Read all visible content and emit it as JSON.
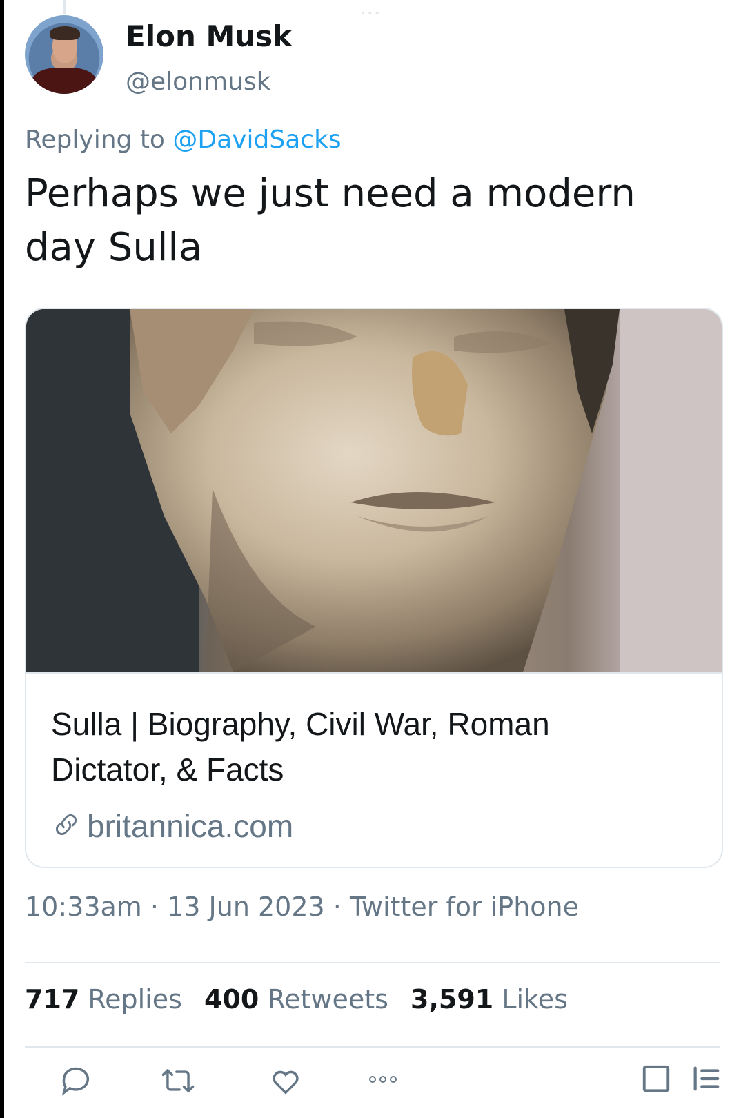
{
  "tweet": {
    "author_name": "Elon Musk",
    "author_handle": "@elonmusk",
    "replying_prefix": "Replying to",
    "replying_handle": "@DavidSacks",
    "text": "Perhaps we just need a modern day Sulla",
    "link_card": {
      "title": "Sulla | Biography, Civil War, Roman Dictator, & Facts",
      "domain": "britannica.com",
      "image_icon": "marble-bust-image"
    },
    "time": "10:33am",
    "date": "13 Jun 2023",
    "source": "Twitter for iPhone",
    "separator": "·",
    "stats": {
      "replies_count": "717",
      "replies_label": "Replies",
      "retweets_count": "400",
      "retweets_label": "Retweets",
      "likes_count": "3,591",
      "likes_label": "Likes"
    }
  },
  "actions": [
    "reply-icon",
    "retweet-icon",
    "like-icon",
    "more-icon",
    "share-icon",
    "menu-icon"
  ],
  "colors": {
    "accent": "#1da1f2",
    "secondary_text": "#657786",
    "primary_text": "#14171a",
    "border": "#e1e8ed"
  }
}
